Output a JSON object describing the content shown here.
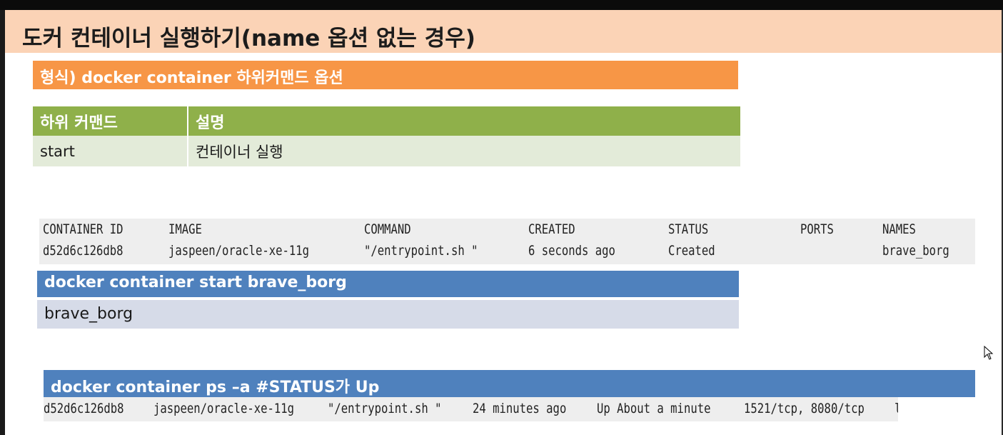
{
  "slide": {
    "title": "도커 컨테이너 실행하기(name 옵션 없는 경우)",
    "format_label": "형식) docker container 하위커맨드 옵션",
    "table": {
      "headers": [
        "하위 커맨드",
        "설명"
      ],
      "rows": [
        [
          "start",
          "컨테이너 실행"
        ]
      ]
    },
    "ps_output": {
      "headers": [
        "CONTAINER ID",
        "IMAGE",
        "COMMAND",
        "CREATED",
        "STATUS",
        "PORTS",
        "NAMES"
      ],
      "row": [
        "d52d6c126db8",
        "jaspeen/oracle-xe-11g",
        "\"/entrypoint.sh \"",
        "6 seconds ago",
        "Created",
        "",
        "brave_borg"
      ]
    },
    "start_command": "docker container start  brave_borg",
    "start_output": "brave_borg",
    "ps_command": "docker container ps –a      #STATUS가 Up",
    "ps2_row": [
      "d52d6c126db8",
      "jaspeen/oracle-xe-11g",
      "\"/entrypoint.sh \"",
      "24 minutes ago",
      "Up About a minute",
      "1521/tcp, 8080/tcp",
      "l"
    ]
  },
  "colors": {
    "title_band": "#fbd3b6",
    "orange": "#f79646",
    "green_header": "#8fb04a",
    "green_cell": "#e3ebd9",
    "blue": "#4f81bd",
    "lavender": "#d6dbe8"
  },
  "icons": [
    "mouse-cursor-icon"
  ]
}
